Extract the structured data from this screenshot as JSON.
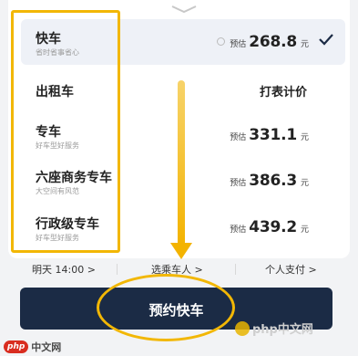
{
  "rides": [
    {
      "name": "快车",
      "sub": "省时省事省心",
      "est": "预估",
      "price": "268.8",
      "unit": "元",
      "selected": true
    },
    {
      "name": "出租车",
      "meter": "打表计价"
    },
    {
      "name": "专车",
      "sub": "好车型好服务",
      "est": "预估",
      "price": "331.1",
      "unit": "元"
    },
    {
      "name": "六座商务专车",
      "sub": "大空间有风范",
      "est": "预估",
      "price": "386.3",
      "unit": "元"
    },
    {
      "name": "行政级专车",
      "sub": "好车型好服务",
      "est": "预估",
      "price": "439.2",
      "unit": "元"
    }
  ],
  "options": {
    "time": "明天 14:00 >",
    "passenger": "选乘车人 >",
    "payment": "个人支付 >"
  },
  "action": {
    "label": "预约快车"
  },
  "watermark": {
    "php": "php",
    "cn": "中文网",
    "right": "php中文网"
  },
  "colors": {
    "accent": "#1b2b45",
    "highlight": "#f2b705"
  },
  "icons": {
    "check": "check-icon",
    "handle": "chevron-down-icon"
  }
}
